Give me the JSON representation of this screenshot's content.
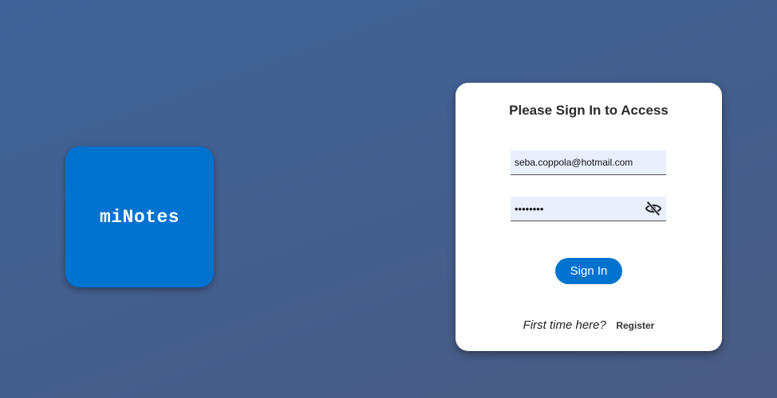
{
  "logo": {
    "text": "miNotes"
  },
  "login_card": {
    "title": "Please Sign In to Access",
    "email_value": "seba.coppola@hotmail.com",
    "password_value": "••••••••",
    "password_toggle_icon": "eye-off-icon",
    "signin_label": "Sign In",
    "register_prompt": "First time here?",
    "register_label": "Register"
  },
  "colors": {
    "accent": "#0073d1",
    "background": "#445e8c",
    "field_background": "#e8f0fe"
  }
}
